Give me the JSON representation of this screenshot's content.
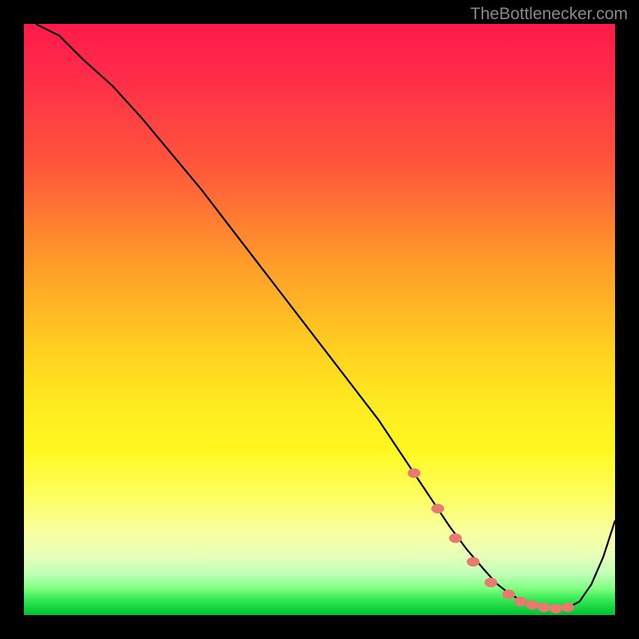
{
  "watermark": "TheBottlenecker.com",
  "chart_data": {
    "type": "line",
    "title": "",
    "xlabel": "",
    "ylabel": "",
    "xlim": [
      0,
      100
    ],
    "ylim": [
      0,
      100
    ],
    "series": [
      {
        "name": "curve",
        "x": [
          2,
          6,
          10,
          15,
          20,
          25,
          30,
          35,
          40,
          45,
          50,
          55,
          60,
          63,
          66,
          69,
          72,
          75,
          78,
          80,
          82,
          84,
          86,
          88,
          90,
          92,
          94,
          96,
          98,
          100
        ],
        "values": [
          100,
          98,
          94,
          89.5,
          84,
          78,
          72,
          65.5,
          59,
          52.5,
          46,
          39.5,
          33,
          28.5,
          24,
          19.5,
          15,
          11,
          7.5,
          5.3,
          3.7,
          2.5,
          1.7,
          1.2,
          1,
          1.2,
          2.3,
          5.2,
          9.8,
          16
        ]
      }
    ],
    "markers": {
      "name": "highlight-points",
      "x": [
        66,
        70,
        73,
        76,
        79,
        82,
        84,
        86,
        88,
        90,
        92
      ],
      "values": [
        24,
        18,
        13,
        9,
        5.5,
        3.5,
        2.3,
        1.7,
        1.3,
        1.1,
        1.3
      ]
    }
  }
}
